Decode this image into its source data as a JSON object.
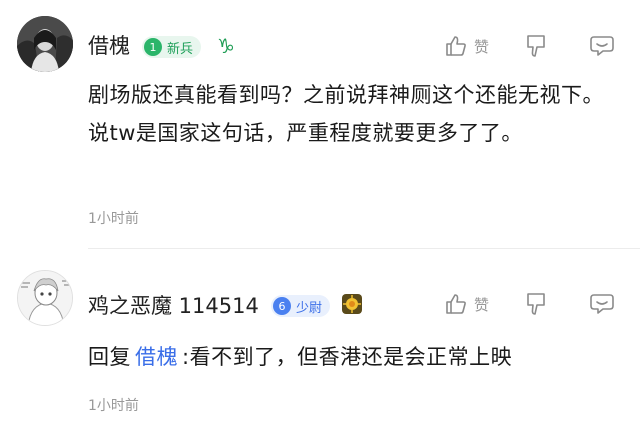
{
  "comments": [
    {
      "username": "借槐",
      "badge_level": "1",
      "badge_label": "新兵",
      "zodiac": "capricorn-icon",
      "like_label": "赞",
      "content": "剧场版还真能看到吗？之前说拜神厕这个还能无视下。说tw是国家这句话，严重程度就要更多了了。",
      "time": "1小时前"
    },
    {
      "username": "鸡之恶魔 114514",
      "badge_level": "6",
      "badge_label": "少尉",
      "medal": "medal-icon",
      "like_label": "赞",
      "reply_prefix": "回复",
      "reply_to": "借槐",
      "content": ":看不到了，但香港还是会正常上映",
      "time": "1小时前"
    }
  ],
  "colors": {
    "green_badge": "#2bb56a",
    "blue_badge": "#4a80f0",
    "mention": "#3a6ee8",
    "muted": "#999999"
  }
}
